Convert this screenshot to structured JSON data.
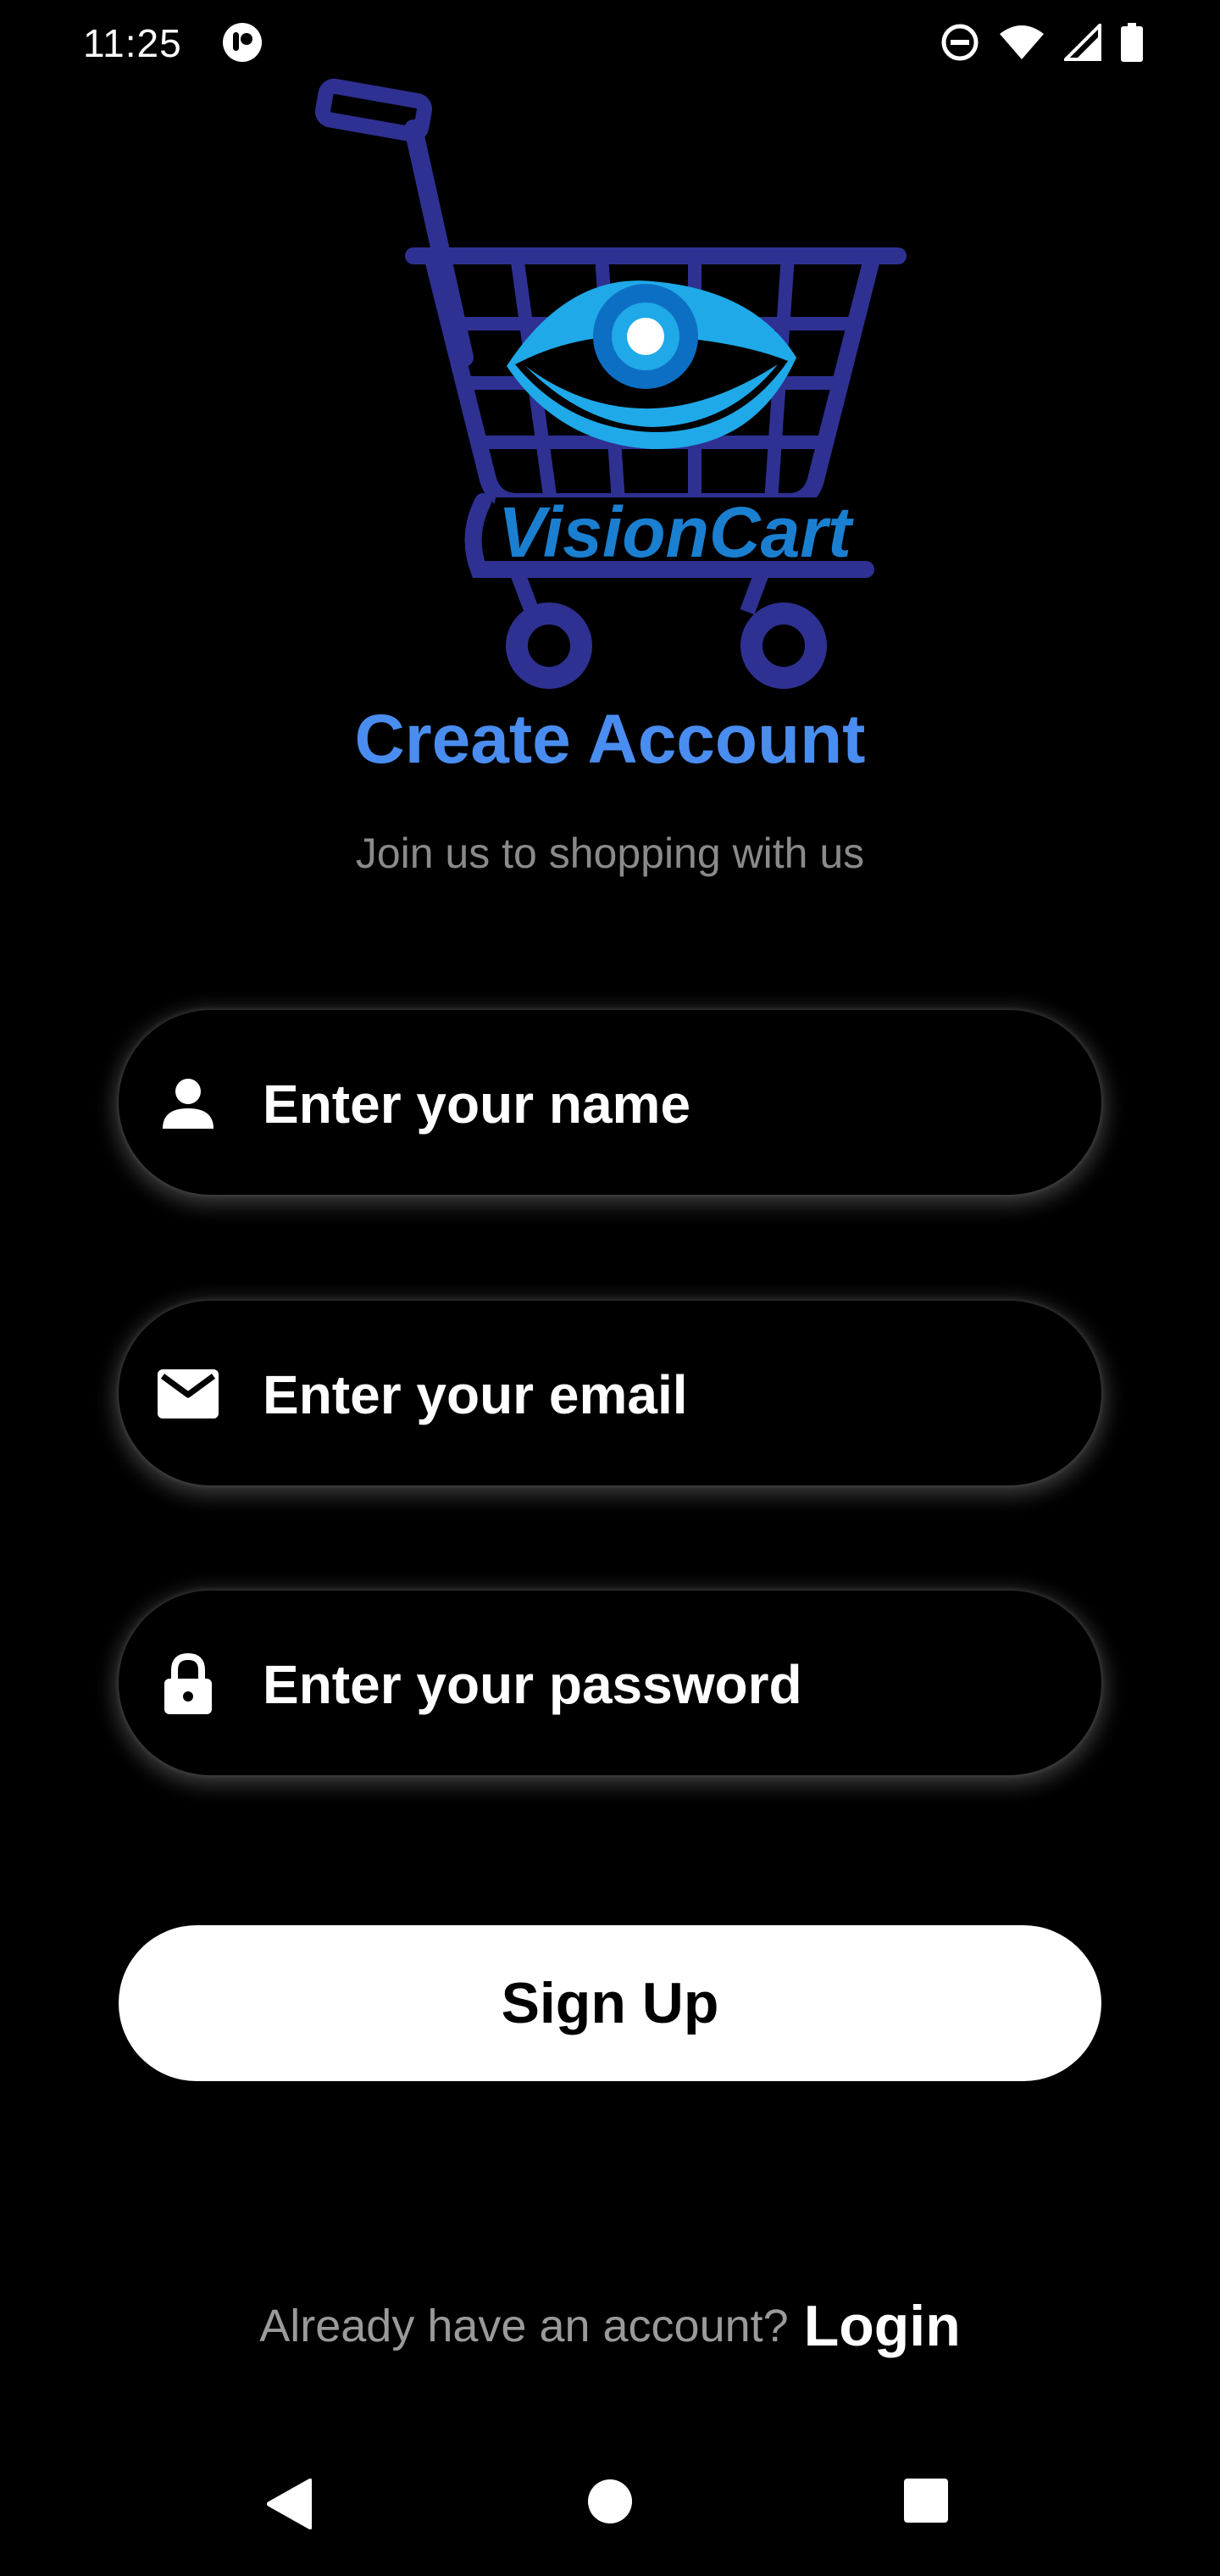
{
  "status_bar": {
    "time": "11:25",
    "icons": [
      "notification-icon",
      "dnd-icon",
      "wifi-icon",
      "signal-icon",
      "battery-icon"
    ]
  },
  "logo": {
    "text": "VisionCart",
    "colors": {
      "cart": "#2e3192",
      "eye_outer": "#1fa9e8",
      "eye_iris": "#0d6fc4",
      "text": "#1a7fd0"
    }
  },
  "header": {
    "title": "Create Account",
    "subtitle": "Join us to shopping with us"
  },
  "form": {
    "name": {
      "icon": "person-icon",
      "placeholder": "Enter your name"
    },
    "email": {
      "icon": "mail-icon",
      "placeholder": "Enter your email"
    },
    "password": {
      "icon": "lock-icon",
      "placeholder": "Enter your password"
    },
    "submit_label": "Sign Up"
  },
  "footer": {
    "prompt": "Already have an account?",
    "login_label": "Login"
  },
  "nav_bar": {
    "icons": [
      "back-icon",
      "home-icon",
      "recents-icon"
    ]
  },
  "colors": {
    "background": "#000000",
    "accent": "#4a8df0",
    "subtitle": "#8a8a8a",
    "button_bg": "#ffffff"
  }
}
